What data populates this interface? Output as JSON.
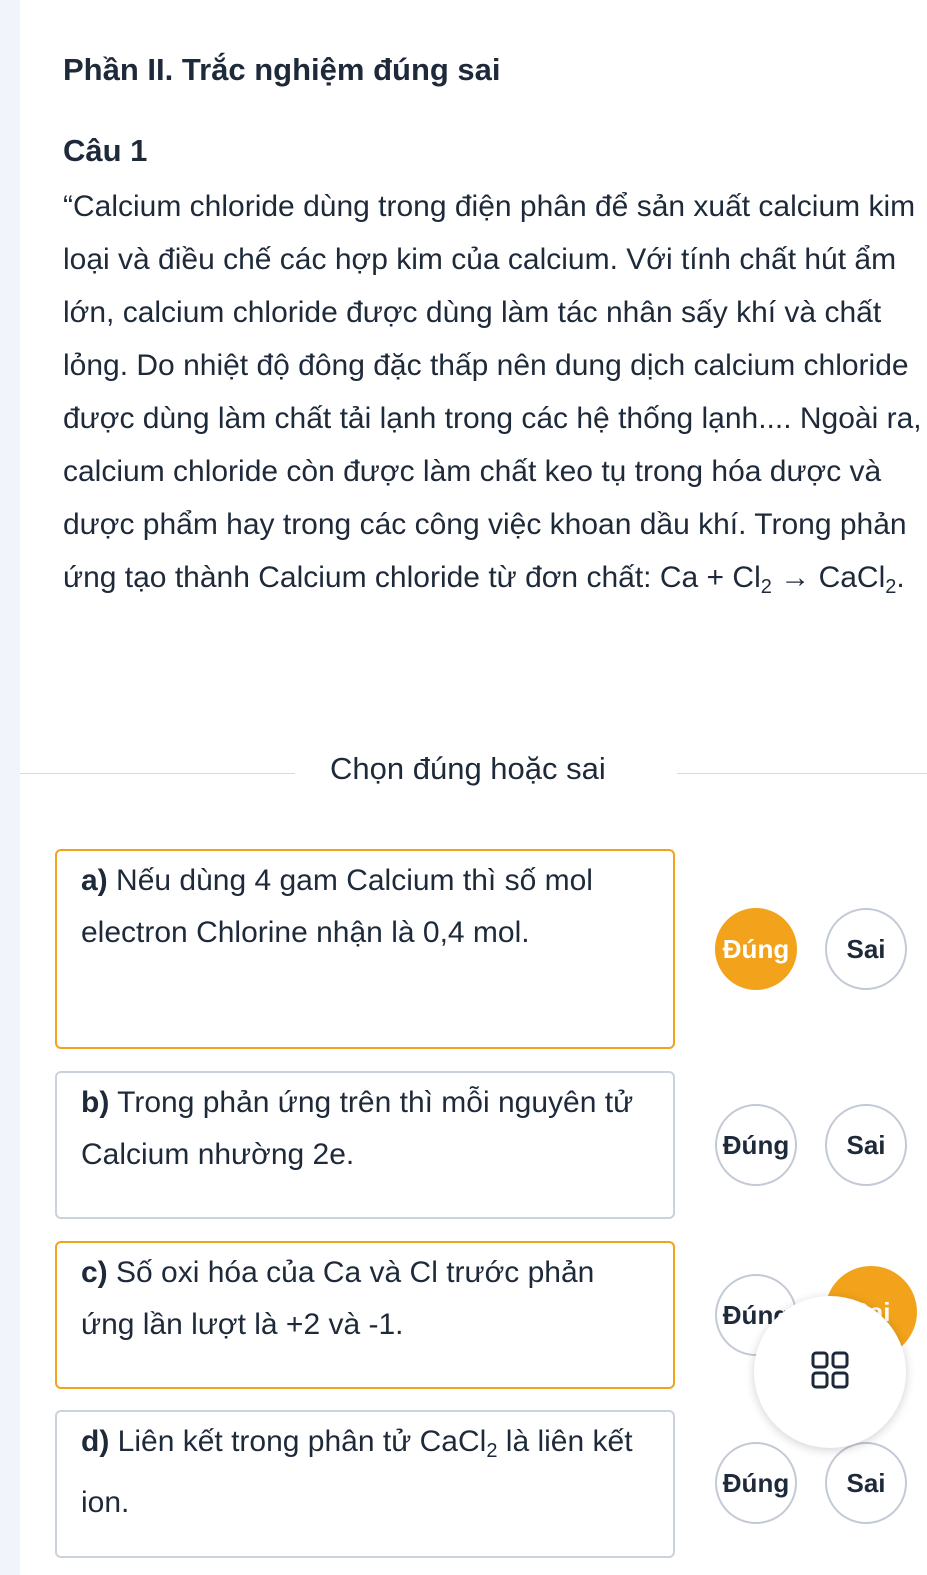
{
  "section_title": "Phần II. Trắc nghiệm đúng sai",
  "question_label": "Câu 1",
  "question_text": "“Calcium chloride dùng trong điện phân để sản xuất calcium kim loại và điều chế các hợp kim của calcium. Với tính chất hút ẩm lớn, calcium chloride được dùng làm tác nhân sấy khí và chất lỏng. Do nhiệt độ đông đặc thấp nên dung dịch calcium chloride được dùng làm chất tải lạnh trong các hệ thống lạnh.... Ngoài ra, calcium chloride còn được làm chất keo tụ trong hóa dược và dược phẩm hay trong các công việc khoan dầu khí. Trong phản ứng tạo thành Calcium chloride từ đơn chất:",
  "equation": {
    "reactant_1": "Ca",
    "plus": "+",
    "reactant_2": "Cl",
    "reactant_2_sub": "2",
    "arrow": "→",
    "product": "CaCl",
    "product_sub": "2",
    "end": "."
  },
  "divider_label": "Chọn đúng hoặc sai",
  "options": [
    {
      "letter": "a)",
      "text": "Nếu dùng 4 gam Calcium thì số mol electron Chlorine nhận là 0,4 mol.",
      "true_label": "Đúng",
      "false_label": "Sai",
      "selected": "true"
    },
    {
      "letter": "b)",
      "text": "Trong phản ứng trên thì mỗi nguyên tử Calcium nhường 2e.",
      "true_label": "Đúng",
      "false_label": "Sai",
      "selected": "none"
    },
    {
      "letter": "c)",
      "text": "Số oxi hóa của Ca và Cl trước phản ứng lần lượt là +2 và -1.",
      "true_label": "Đúng",
      "false_label": "Sai",
      "selected": "false"
    },
    {
      "letter": "d)",
      "text_before": "Liên kết trong phân tử",
      "formula": "CaCl",
      "formula_sub": "2",
      "text_after": "là liên kết ion.",
      "true_label": "Đúng",
      "false_label": "Sai",
      "selected": "none"
    }
  ],
  "floating_button_icon": "grid-icon",
  "colors": {
    "accent": "#f2a31b",
    "text": "#1e2a3a",
    "border": "#cbd2dc"
  }
}
